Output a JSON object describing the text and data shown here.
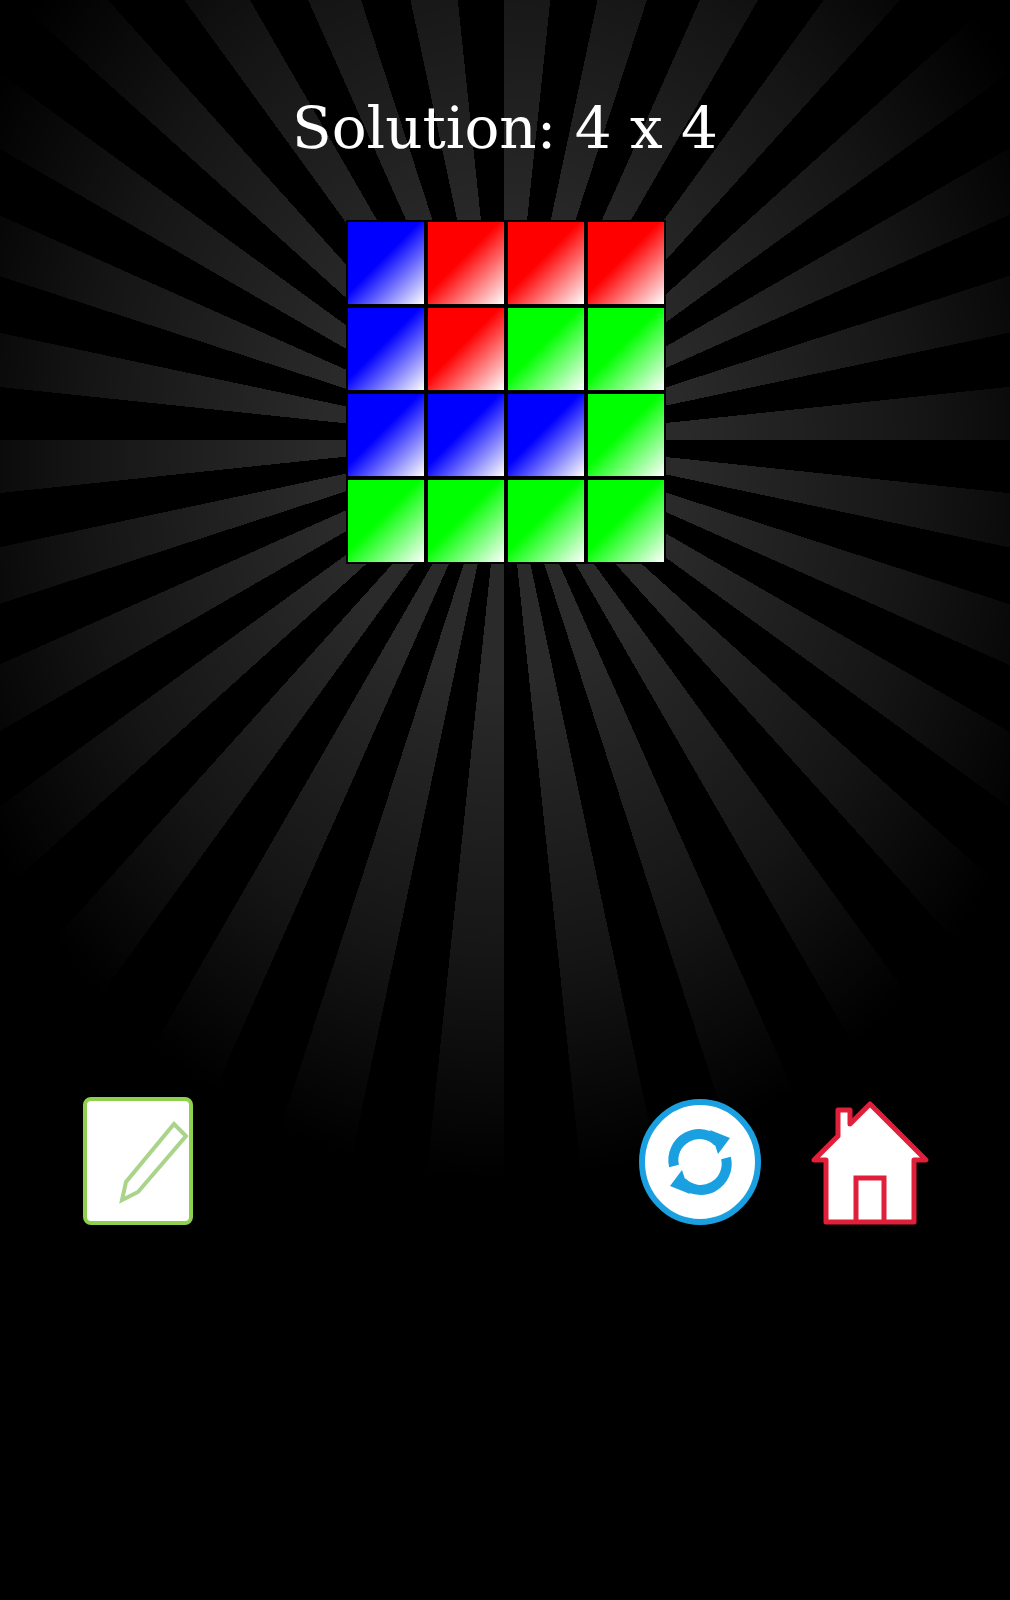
{
  "title": "Solution: 4 x 4",
  "grid": [
    [
      {
        "color": "#0000ff"
      },
      {
        "color": "#ff0000"
      },
      {
        "color": "#ff0000"
      },
      {
        "color": "#ff0000"
      }
    ],
    [
      {
        "color": "#0000ff"
      },
      {
        "color": "#ff0000"
      },
      {
        "color": "#00ff00"
      },
      {
        "color": "#00ff00"
      }
    ],
    [
      {
        "color": "#0000ff"
      },
      {
        "color": "#0000ff"
      },
      {
        "color": "#0000ff"
      },
      {
        "color": "#00ff00"
      }
    ],
    [
      {
        "color": "#00ff00"
      },
      {
        "color": "#00ff00"
      },
      {
        "color": "#00ff00"
      },
      {
        "color": "#00ff00"
      }
    ]
  ]
}
